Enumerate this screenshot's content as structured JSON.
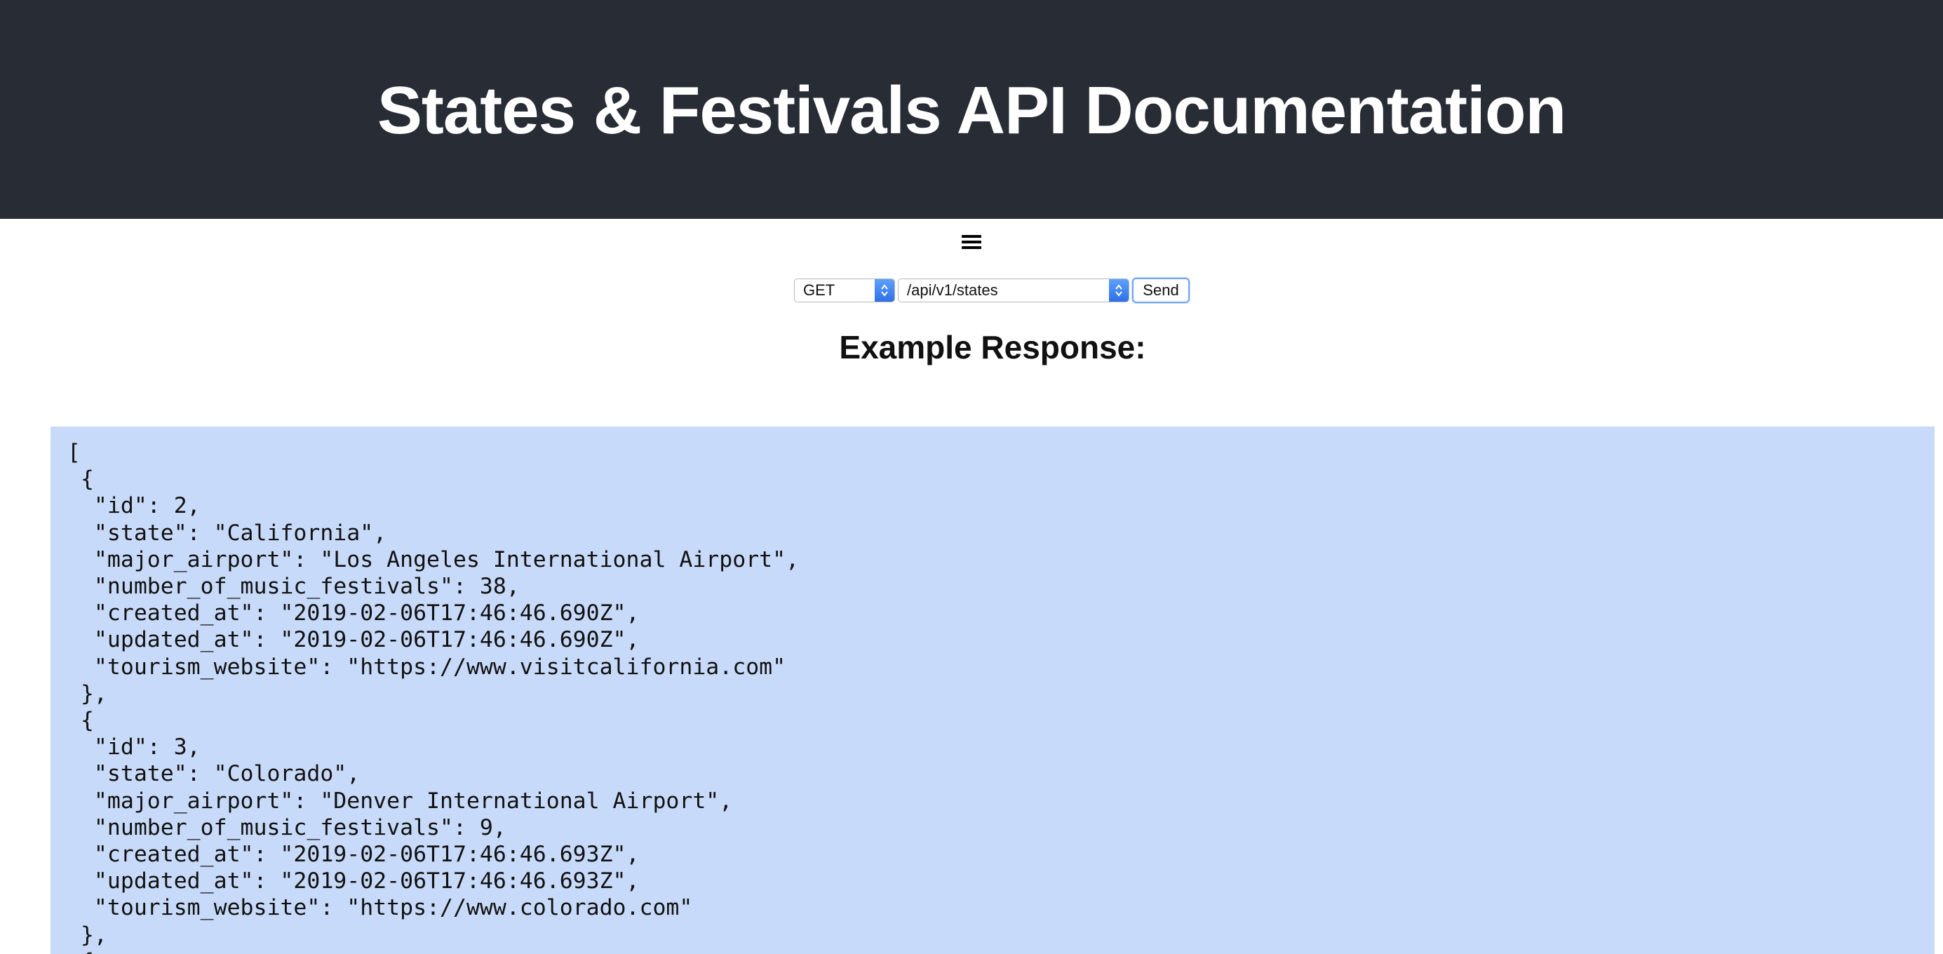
{
  "header": {
    "title": "States & Festivals API Documentation"
  },
  "menu": {
    "icon": "hamburger-menu-icon"
  },
  "request": {
    "method": "GET",
    "endpoint": "/api/v1/states",
    "send_label": "Send"
  },
  "response": {
    "heading": "Example Response:",
    "body": "[\n {\n  \"id\": 2,\n  \"state\": \"California\",\n  \"major_airport\": \"Los Angeles International Airport\",\n  \"number_of_music_festivals\": 38,\n  \"created_at\": \"2019-02-06T17:46:46.690Z\",\n  \"updated_at\": \"2019-02-06T17:46:46.690Z\",\n  \"tourism_website\": \"https://www.visitcalifornia.com\"\n },\n {\n  \"id\": 3,\n  \"state\": \"Colorado\",\n  \"major_airport\": \"Denver International Airport\",\n  \"number_of_music_festivals\": 9,\n  \"created_at\": \"2019-02-06T17:46:46.693Z\",\n  \"updated_at\": \"2019-02-06T17:46:46.693Z\",\n  \"tourism_website\": \"https://www.colorado.com\"\n },\n {"
  },
  "colors": {
    "header_bg": "#282c34",
    "header_text": "#ffffff",
    "response_bg": "#c8daf9",
    "select_arrow": "#2e6fe6"
  }
}
